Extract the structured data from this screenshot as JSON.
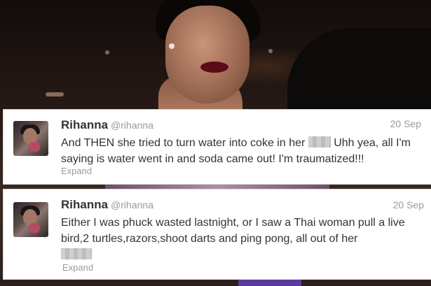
{
  "tweets": [
    {
      "name": "Rihanna",
      "handle": "@rihanna",
      "date": "20 Sep",
      "text_part1": "And THEN she tried to turn water into coke in her ",
      "text_part2": " Uhh yea, all I'm saying is water went in and soda came out! I'm traumatized!!!",
      "expand_label": "Expand"
    },
    {
      "name": "Rihanna",
      "handle": "@rihanna",
      "date": "20 Sep",
      "text_part1": "Either I was phuck wasted lastnight, or I saw a Thai woman pull a live bird,2 turtles,razors,shoot darts and ping pong, all out of her",
      "expand_label": "Expand"
    }
  ],
  "icons": {
    "avatar": "profile-photo",
    "redaction": "pixelated-censor-block"
  }
}
